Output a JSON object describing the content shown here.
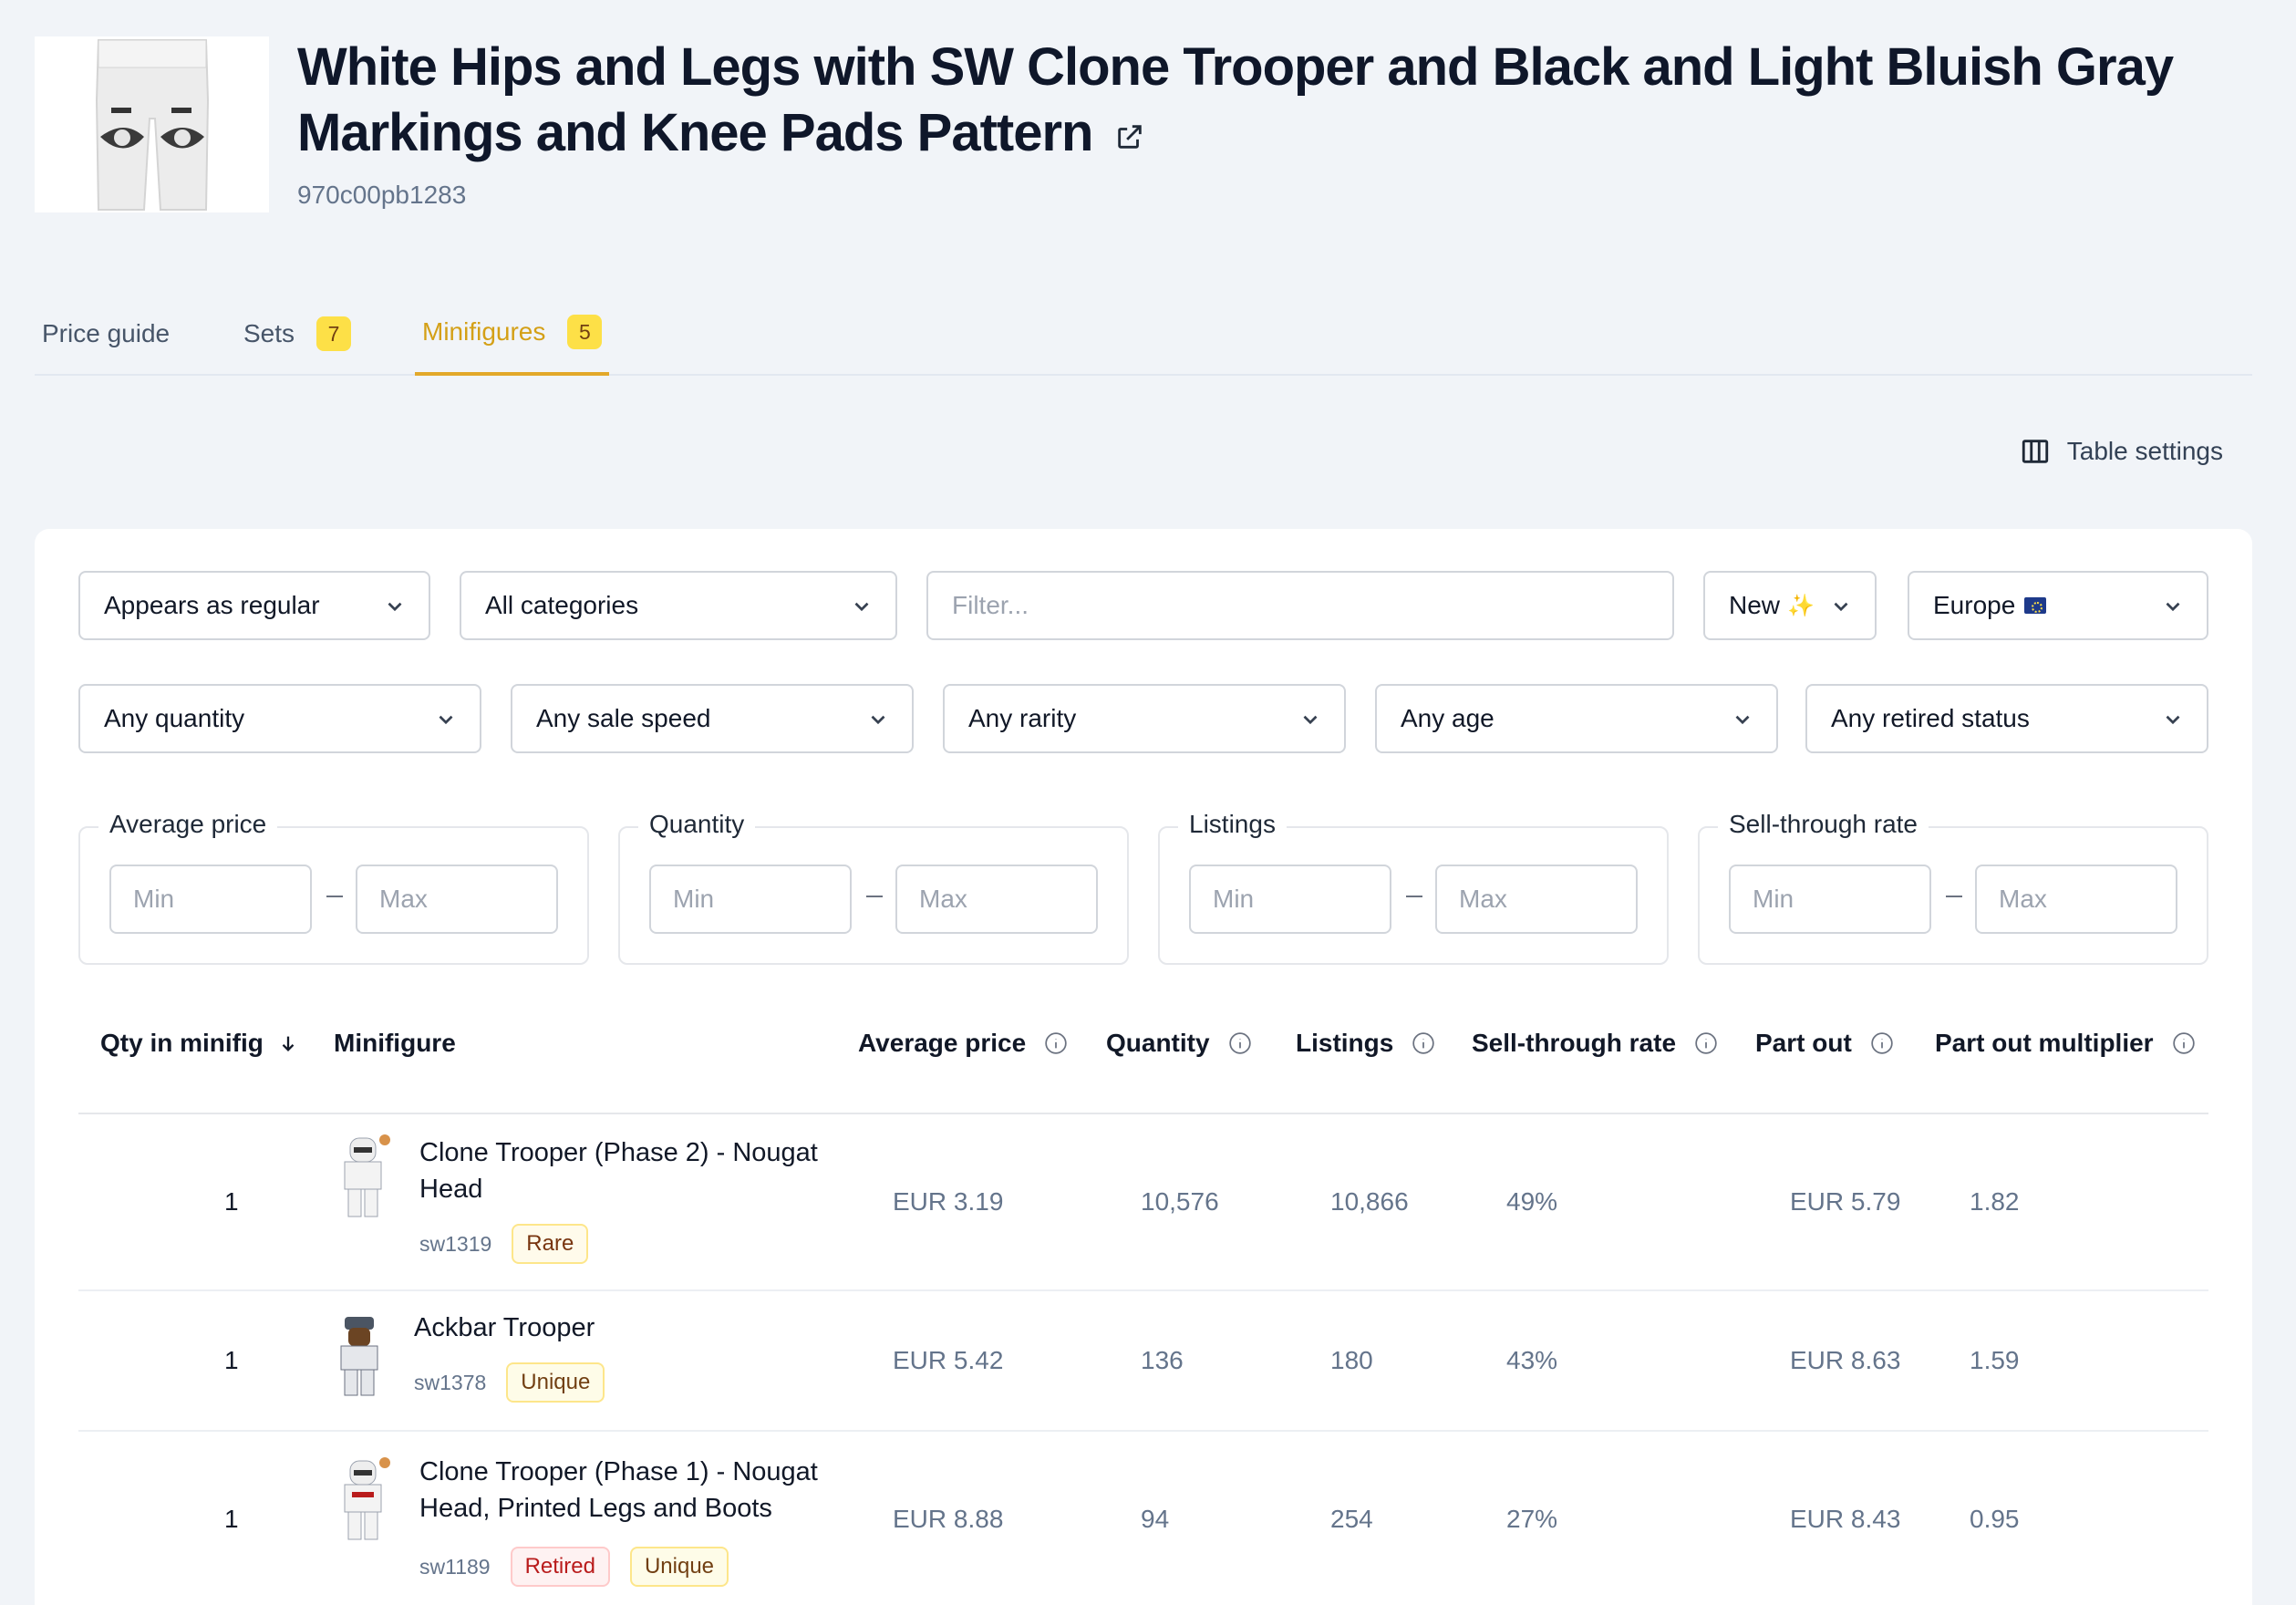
{
  "header": {
    "title": "White Hips and Legs with SW Clone Trooper and Black and Light Bluish Gray Markings and Knee Pads Pattern",
    "part_id": "970c00pb1283"
  },
  "tabs": [
    {
      "label": "Price guide",
      "count": ""
    },
    {
      "label": "Sets",
      "count": "7"
    },
    {
      "label": "Minifigures",
      "count": "5"
    }
  ],
  "toolbar": {
    "table_settings": "Table settings"
  },
  "filters": {
    "appearance": "Appears as regular",
    "category": "All categories",
    "search_placeholder": "Filter...",
    "condition": "New",
    "condition_icon": "sparkles-icon",
    "region": "Europe",
    "region_icon": "eu-flag-icon",
    "quantity": "Any quantity",
    "sale_speed": "Any sale speed",
    "rarity": "Any rarity",
    "age": "Any age",
    "retired": "Any retired status"
  },
  "ranges": [
    {
      "label": "Average price",
      "min": "Min",
      "max": "Max"
    },
    {
      "label": "Quantity",
      "min": "Min",
      "max": "Max"
    },
    {
      "label": "Listings",
      "min": "Min",
      "max": "Max"
    },
    {
      "label": "Sell-through rate",
      "min": "Min",
      "max": "Max"
    }
  ],
  "table": {
    "columns": [
      "Qty in minifig",
      "Minifigure",
      "Average price",
      "Quantity",
      "Listings",
      "Sell-through rate",
      "Part out",
      "Part out multiplier"
    ],
    "rows": [
      {
        "qty": "1",
        "name_line1": "Clone Trooper (Phase 2) - Nougat",
        "name_line2": "Head",
        "id": "sw1319",
        "tag1": "Rare",
        "tag2": "",
        "avg_price": "EUR 3.19",
        "quantity": "10,576",
        "listings": "10,866",
        "sell_through": "49%",
        "part_out": "EUR 5.79",
        "multiplier": "1.82"
      },
      {
        "qty": "1",
        "name_line1": "Ackbar Trooper",
        "name_line2": "",
        "id": "sw1378",
        "tag1": "Unique",
        "tag2": "",
        "avg_price": "EUR 5.42",
        "quantity": "136",
        "listings": "180",
        "sell_through": "43%",
        "part_out": "EUR 8.63",
        "multiplier": "1.59"
      },
      {
        "qty": "1",
        "name_line1": "Clone Trooper (Phase 1) - Nougat",
        "name_line2": "Head, Printed Legs and Boots",
        "id": "sw1189",
        "tag1": "Retired",
        "tag2": "Unique",
        "avg_price": "EUR 8.88",
        "quantity": "94",
        "listings": "254",
        "sell_through": "27%",
        "part_out": "EUR 8.43",
        "multiplier": "0.95"
      }
    ]
  }
}
